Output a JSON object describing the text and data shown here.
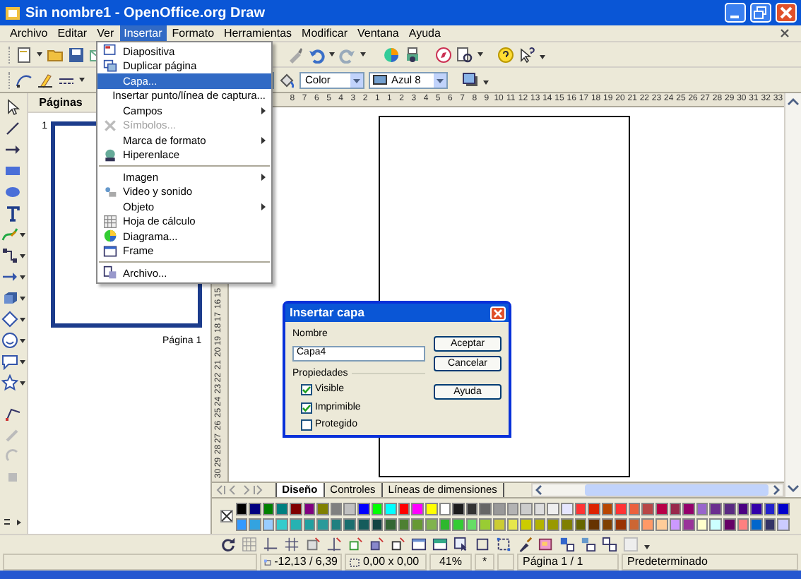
{
  "window": {
    "title": "Sin nombre1 - OpenOffice.org Draw"
  },
  "menu_bar": [
    {
      "label": "Archivo",
      "selected": false
    },
    {
      "label": "Editar",
      "selected": false
    },
    {
      "label": "Ver",
      "selected": false
    },
    {
      "label": "Insertar",
      "selected": true
    },
    {
      "label": "Formato",
      "selected": false
    },
    {
      "label": "Herramientas",
      "selected": false
    },
    {
      "label": "Modificar",
      "selected": false
    },
    {
      "label": "Ventana",
      "selected": false
    },
    {
      "label": "Ayuda",
      "selected": false
    }
  ],
  "insert_menu": {
    "groups": [
      [
        {
          "label": "Diapositiva",
          "selected": false,
          "disabled": false,
          "submenu": false
        },
        {
          "label": "Duplicar página",
          "selected": false,
          "disabled": false,
          "submenu": false
        },
        {
          "label": "Capa...",
          "selected": true,
          "disabled": false,
          "submenu": false
        },
        {
          "label": "Insertar punto/línea de captura...",
          "selected": false,
          "disabled": false,
          "submenu": false
        },
        {
          "label": "Campos",
          "selected": false,
          "disabled": false,
          "submenu": true
        },
        {
          "label": "Símbolos...",
          "selected": false,
          "disabled": true,
          "submenu": false
        },
        {
          "label": "Marca de formato",
          "selected": false,
          "disabled": false,
          "submenu": true
        },
        {
          "label": "Hiperenlace",
          "selected": false,
          "disabled": false,
          "submenu": false
        }
      ],
      [
        {
          "label": "Imagen",
          "selected": false,
          "disabled": false,
          "submenu": true
        },
        {
          "label": "Video y sonido",
          "selected": false,
          "disabled": false,
          "submenu": false
        },
        {
          "label": "Objeto",
          "selected": false,
          "disabled": false,
          "submenu": true
        },
        {
          "label": "Hoja de cálculo",
          "selected": false,
          "disabled": false,
          "submenu": false
        },
        {
          "label": "Diagrama...",
          "selected": false,
          "disabled": false,
          "submenu": false
        },
        {
          "label": "Frame",
          "selected": false,
          "disabled": false,
          "submenu": false
        }
      ],
      [
        {
          "label": "Archivo...",
          "selected": false,
          "disabled": false,
          "submenu": false
        }
      ]
    ]
  },
  "toolbar": {
    "fill_style": "Color",
    "fill_color": "Azul 8"
  },
  "pages_panel": {
    "title": "Páginas",
    "pages": [
      {
        "number": "1",
        "caption": "Página 1",
        "selected": true
      }
    ]
  },
  "ruler_horizontal": [
    "8",
    "7",
    "6",
    "5",
    "4",
    "3",
    "2",
    "1",
    "1",
    "2",
    "3",
    "4",
    "5",
    "6",
    "7",
    "8",
    "9",
    "10",
    "11",
    "12",
    "13",
    "14",
    "15",
    "16",
    "17",
    "18",
    "19",
    "20",
    "21",
    "22",
    "23",
    "24",
    "25",
    "26",
    "27",
    "28",
    "29",
    "30",
    "31",
    "32",
    "33"
  ],
  "ruler_vertical": [
    "15",
    "16",
    "17",
    "18",
    "19",
    "20",
    "21",
    "22",
    "23",
    "24",
    "25",
    "26",
    "27",
    "28",
    "29",
    "30"
  ],
  "layer_tabs": [
    {
      "label": "Diseño",
      "selected": true
    },
    {
      "label": "Controles",
      "selected": false
    },
    {
      "label": "Líneas de dimensiones",
      "selected": false
    }
  ],
  "palette": {
    "rows": [
      [
        {
          "color": "#000000"
        },
        {
          "color": "#000080"
        },
        {
          "color": "#008000"
        },
        {
          "color": "#008080"
        },
        {
          "color": "#800000"
        },
        {
          "color": "#800080"
        },
        {
          "color": "#808000"
        },
        {
          "color": "#808080"
        },
        {
          "color": "#c0c0c0"
        },
        {
          "color": "#0000ff"
        },
        {
          "color": "#00ff00"
        },
        {
          "color": "#00ffff"
        },
        {
          "color": "#ff0000"
        },
        {
          "color": "#ff00ff"
        },
        {
          "color": "#ffff00"
        },
        {
          "color": "#ffffff"
        },
        {
          "color": "#1c1c1c"
        },
        {
          "color": "#333333"
        },
        {
          "color": "#666666"
        },
        {
          "color": "#999999"
        },
        {
          "color": "#b3b3b3"
        },
        {
          "color": "#cccccc"
        },
        {
          "color": "#dddddd"
        },
        {
          "color": "#eeeeee"
        },
        {
          "color": "#e6e6ff"
        },
        {
          "color": "#ff3333"
        },
        {
          "color": "#dc2300"
        },
        {
          "color": "#b84700"
        },
        {
          "color": "#ff3334"
        },
        {
          "color": "#eb613d"
        },
        {
          "color": "#b84747"
        },
        {
          "color": "#b80047"
        },
        {
          "color": "#99284c"
        },
        {
          "color": "#94006b"
        },
        {
          "color": "#9966cc"
        },
        {
          "color": "#6b2e8f"
        },
        {
          "color": "#5a2a82"
        },
        {
          "color": "#4b0082"
        },
        {
          "color": "#3300aa"
        },
        {
          "color": "#2222cc"
        },
        {
          "color": "#0000cc"
        }
      ],
      [
        {
          "color": "#3399ff"
        },
        {
          "color": "#33a3e0"
        },
        {
          "color": "#99ccff"
        },
        {
          "color": "#33cccc"
        },
        {
          "color": "#26b2b2"
        },
        {
          "color": "#20a0a0"
        },
        {
          "color": "#2b9a9a"
        },
        {
          "color": "#208080"
        },
        {
          "color": "#1a6e6e"
        },
        {
          "color": "#155c5c"
        },
        {
          "color": "#124444"
        },
        {
          "color": "#336633"
        },
        {
          "color": "#4d8033"
        },
        {
          "color": "#669933"
        },
        {
          "color": "#80b34d"
        },
        {
          "color": "#2db82d"
        },
        {
          "color": "#33cc33"
        },
        {
          "color": "#66dd66"
        },
        {
          "color": "#99cc33"
        },
        {
          "color": "#cccc33"
        },
        {
          "color": "#e6e64c"
        },
        {
          "color": "#cccc00"
        },
        {
          "color": "#b3b300"
        },
        {
          "color": "#999900"
        },
        {
          "color": "#808001"
        },
        {
          "color": "#666600"
        },
        {
          "color": "#663300"
        },
        {
          "color": "#804000"
        },
        {
          "color": "#993300"
        },
        {
          "color": "#cc6633"
        },
        {
          "color": "#ff9966"
        },
        {
          "color": "#ffcc99"
        },
        {
          "color": "#cc99ff"
        },
        {
          "color": "#993399"
        },
        {
          "color": "#ffffcc"
        },
        {
          "color": "#ccffff"
        },
        {
          "color": "#660066"
        },
        {
          "color": "#ff8080"
        },
        {
          "color": "#0066cc"
        },
        {
          "color": "#333366"
        },
        {
          "color": "#ccccff"
        }
      ]
    ]
  },
  "status_bar": {
    "position": "-12,13 / 6,39",
    "size": "0,00 x 0,00",
    "zoom": "41%",
    "modified": "*",
    "page": "Página 1 / 1",
    "style": "Predeterminado"
  },
  "dialog": {
    "title": "Insertar capa",
    "name_label": "Nombre",
    "name_value": "Capa4",
    "group_label": "Propiedades",
    "options": [
      {
        "label": "Visible",
        "checked": true
      },
      {
        "label": "Imprimible",
        "checked": true
      },
      {
        "label": "Protegido",
        "checked": false
      }
    ],
    "buttons": [
      "Aceptar",
      "Cancelar",
      "Ayuda"
    ]
  }
}
